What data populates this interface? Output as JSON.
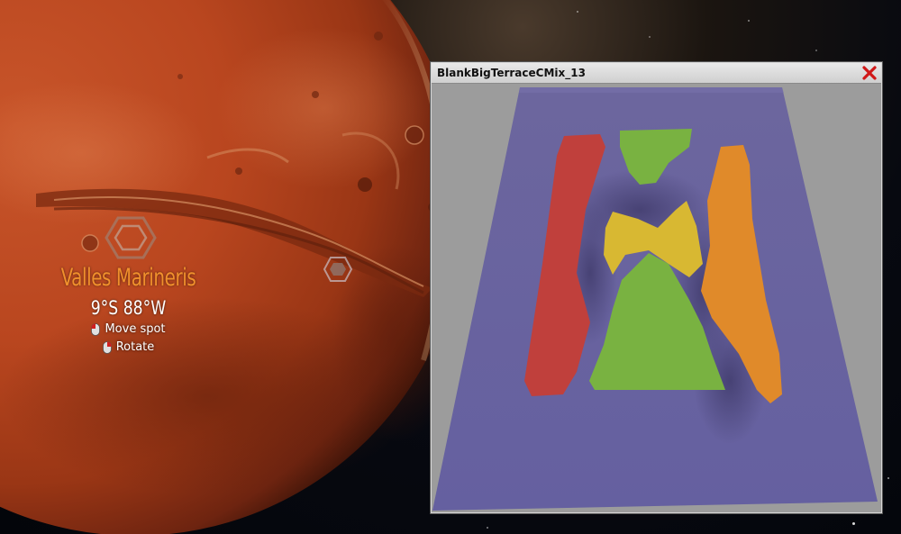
{
  "location": {
    "name": "Valles Marineris",
    "coordinates": "9°S 88°W"
  },
  "controls": [
    {
      "label": "Move spot",
      "icon": "mouse-left-icon"
    },
    {
      "label": "Rotate",
      "icon": "mouse-right-icon"
    }
  ],
  "preview_window": {
    "title": "BlankBigTerraceCMix_13",
    "close_icon": "close-icon"
  },
  "colors": {
    "site_name": "#f0902c",
    "terrain_base": "#6a63a0",
    "zone_red": "#c0403c",
    "zone_green": "#79b241",
    "zone_yellow": "#d8b832",
    "zone_orange": "#e08a2a",
    "close": "#d01818"
  }
}
